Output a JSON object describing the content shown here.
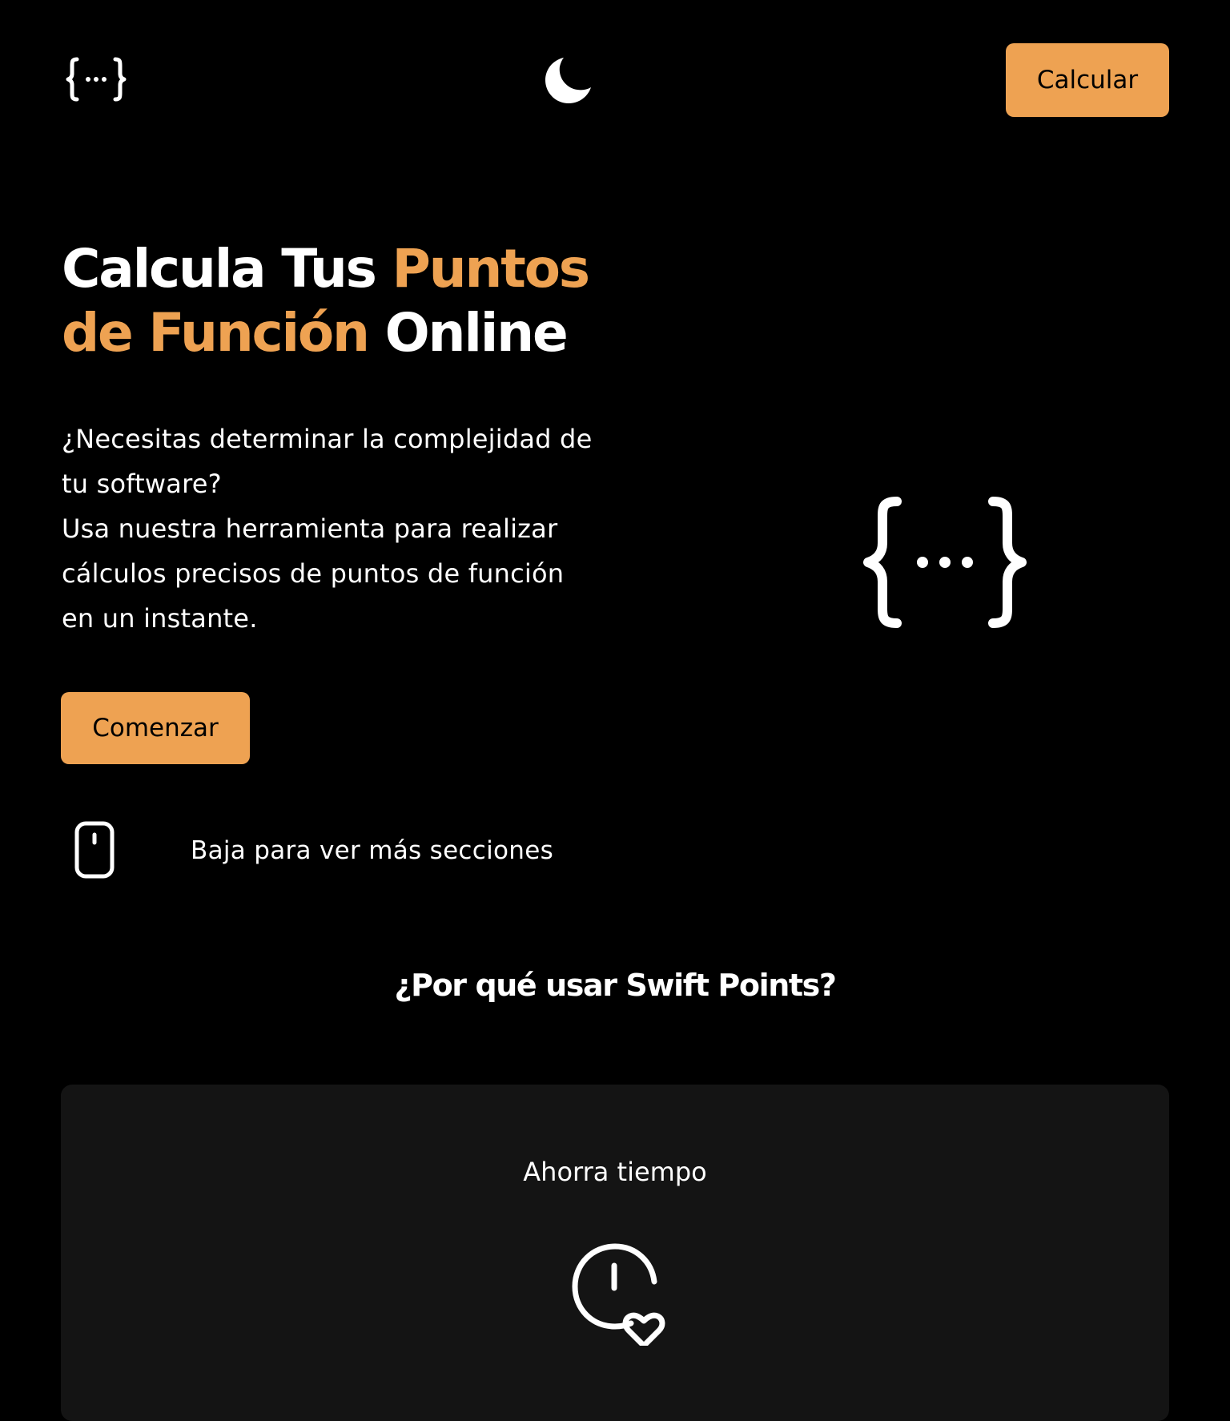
{
  "header": {
    "logo_icon": "curly-braces-ellipsis-icon",
    "theme_toggle_icon": "moon-icon",
    "cta_label": "Calcular"
  },
  "hero": {
    "title_part1": "Calcula Tus ",
    "title_accent1": "Puntos",
    "title_accent2": "de Función",
    "title_part2": " Online",
    "description_line1": "¿Necesitas determinar la complejidad de",
    "description_line2": "tu software?",
    "description_line3": "Usa nuestra herramienta para realizar",
    "description_line4": "cálculos precisos de puntos de función",
    "description_line5": "en un instante.",
    "button_label": "Comenzar",
    "illustration_icon": "curly-braces-ellipsis-icon"
  },
  "scroll_hint": {
    "icon": "mouse-icon",
    "text": "Baja para ver más secciones"
  },
  "why_section": {
    "title": "¿Por qué usar Swift Points?",
    "cards": [
      {
        "title": "Ahorra tiempo",
        "icon": "clock-heart-icon"
      }
    ]
  },
  "colors": {
    "background": "#000000",
    "accent": "#EEA252",
    "card_background": "#141414",
    "text": "#FFFFFF"
  }
}
